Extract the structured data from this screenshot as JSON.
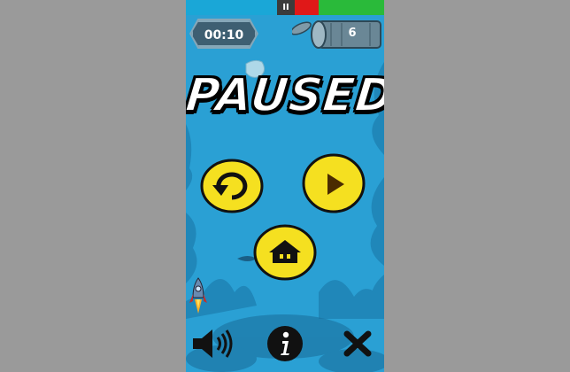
{
  "top_bar": {
    "pause_label": "II",
    "colors": {
      "left": "#1aa7d7",
      "pause": "#3b3b3b",
      "red": "#e01818",
      "green": "#2aba3a"
    }
  },
  "hud": {
    "timer": "00:10",
    "can_count": "6"
  },
  "overlay": {
    "title": "PAUSED"
  },
  "buttons": {
    "restart_icon": "restart-icon",
    "play_icon": "play-icon",
    "home_icon": "home-icon",
    "sound_icon": "speaker-icon",
    "info_icon": "info-icon",
    "close_icon": "close-icon",
    "info_label": "i"
  },
  "colors": {
    "water": "#2aa0d4",
    "button_yellow": "#f5e020",
    "button_outline": "#111111",
    "page_bg": "#9a9a9a"
  }
}
